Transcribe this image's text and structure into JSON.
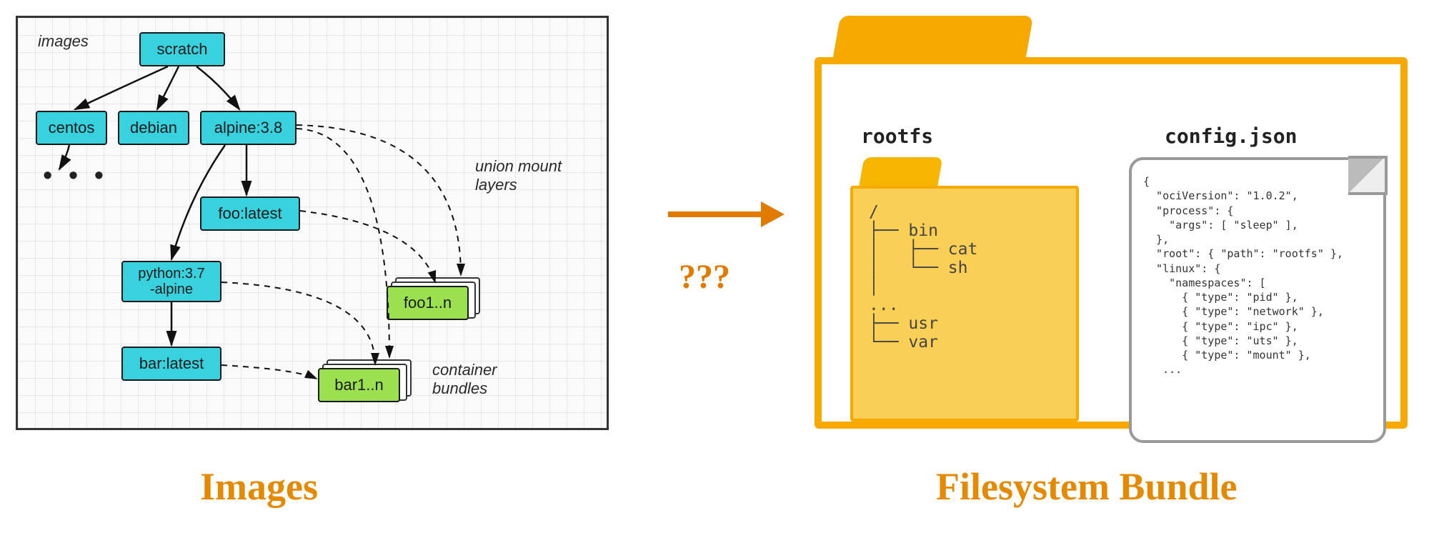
{
  "labels": {
    "images_header": "images",
    "umount": "union mount\nlayers",
    "bundles": "container\nbundles",
    "images_big": "Images",
    "bundle_big": "Filesystem Bundle",
    "qmarks": "???"
  },
  "nodes": {
    "scratch": "scratch",
    "centos": "centos",
    "debian": "debian",
    "alpine": "alpine:3.8",
    "foo": "foo:latest",
    "python": "python:3.7\n-alpine",
    "bar": "bar:latest",
    "foostack": "foo1..n",
    "barstack": "bar1..n"
  },
  "right": {
    "rootfs_title": "rootfs",
    "config_title": "config.json",
    "rootfs_tree": "/\n├── bin\n│   ├── cat\n│   └── sh\n│\n...\n├── usr\n└── var",
    "config_text": "{\n  \"ociVersion\": \"1.0.2\",\n  \"process\": {\n    \"args\": [ \"sleep\" ],\n  },\n  \"root\": { \"path\": \"rootfs\" },\n  \"linux\": {\n    \"namespaces\": [\n      { \"type\": \"pid\" },\n      { \"type\": \"network\" },\n      { \"type\": \"ipc\" },\n      { \"type\": \"uts\" },\n      { \"type\": \"mount\" },\n   ..."
  },
  "chart_data": {
    "type": "diagram",
    "title": "Images to Filesystem Bundle",
    "left_graph": {
      "nodes": [
        "scratch",
        "centos",
        "debian",
        "alpine:3.8",
        "foo:latest",
        "python:3.7-alpine",
        "bar:latest",
        "foo1..n",
        "bar1..n"
      ],
      "edges_solid": [
        [
          "scratch",
          "centos"
        ],
        [
          "scratch",
          "debian"
        ],
        [
          "scratch",
          "alpine:3.8"
        ],
        [
          "alpine:3.8",
          "foo:latest"
        ],
        [
          "alpine:3.8",
          "python:3.7-alpine"
        ],
        [
          "python:3.7-alpine",
          "bar:latest"
        ]
      ],
      "edges_dashed_to_foo_stack": [
        "scratch",
        "alpine:3.8",
        "foo:latest"
      ],
      "edges_dashed_to_bar_stack": [
        "scratch",
        "alpine:3.8",
        "python:3.7-alpine",
        "bar:latest"
      ]
    },
    "right_bundle": {
      "rootfs_tree": [
        "/",
        "bin",
        "bin/cat",
        "bin/sh",
        "...",
        "usr",
        "var"
      ],
      "config_json": {
        "ociVersion": "1.0.2",
        "process": {
          "args": [
            "sleep"
          ]
        },
        "root": {
          "path": "rootfs"
        },
        "linux": {
          "namespaces": [
            {
              "type": "pid"
            },
            {
              "type": "network"
            },
            {
              "type": "ipc"
            },
            {
              "type": "uts"
            },
            {
              "type": "mount"
            }
          ]
        }
      }
    },
    "transition": "???"
  }
}
